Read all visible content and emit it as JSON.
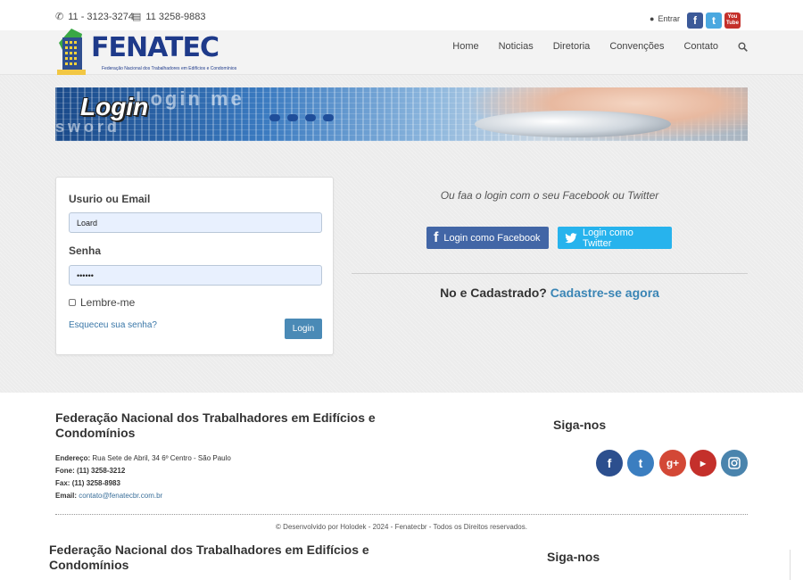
{
  "topbar": {
    "phone1": "11 - 3123-3274",
    "phone2": "11 3258-9883",
    "entrar": "Entrar",
    "youtube_label": "You Tube"
  },
  "header": {
    "logo_text": "FENATEC",
    "logo_sub": "Federação Nacional dos Trabalhadores em Edifícios e Condomínios",
    "nav": [
      "Home",
      "Noticias",
      "Diretoria",
      "Convenções",
      "Contato"
    ]
  },
  "banner": {
    "title": "Login",
    "ghost1": "Login me",
    "ghost2": "sword"
  },
  "login_form": {
    "user_label": "Usurio ou Email",
    "user_value": "Loard",
    "pass_label": "Senha",
    "pass_value": "••••••",
    "remember_label": "Lembre-me",
    "forgot_link": "Esqueceu sua senha?",
    "submit_label": "Login"
  },
  "social_login": {
    "intro": "Ou faa o login com o seu Facebook ou Twitter",
    "facebook_label": "Login como Facebook",
    "twitter_label": "Login como Twitter",
    "register_prompt": "No e Cadastrado?",
    "register_link": "Cadastre-se agora"
  },
  "footer": {
    "org_name": "Federação Nacional dos Trabalhadores em Edifícios e Condomínios",
    "address_label": "Endereço:",
    "address": "Rua Sete de Abril, 34 6º Centro - São Paulo",
    "phone_label": "Fone:",
    "phone": "(11) 3258-3212",
    "fax_label": "Fax:",
    "fax": "(11) 3258-8983",
    "email_label": "Email:",
    "email": "contato@fenatecbr.com.br",
    "follow_title": "Siga-nos",
    "copyright": "© Desenvolvido por Holodek - 2024 - Fenatecbr - Todos os Direitos reservados."
  },
  "colors": {
    "accent": "#4a8ab6",
    "facebook": "#4266a6",
    "twitter": "#27b3ed",
    "link": "#3a85b5"
  }
}
